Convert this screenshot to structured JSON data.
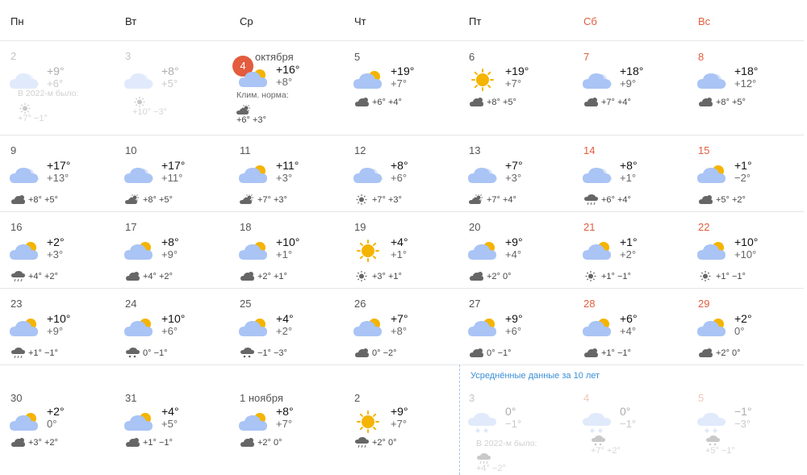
{
  "weekdays": [
    {
      "label": "Пн",
      "weekend": false
    },
    {
      "label": "Вт",
      "weekend": false
    },
    {
      "label": "Ср",
      "weekend": false
    },
    {
      "label": "Чт",
      "weekend": false
    },
    {
      "label": "Пт",
      "weekend": false
    },
    {
      "label": "Сб",
      "weekend": true
    },
    {
      "label": "Вс",
      "weekend": true
    }
  ],
  "today": {
    "day": "4",
    "month": "октября",
    "tmax": "+16°",
    "tmin": "+8°",
    "clim_label": "Клим. норма:",
    "clim": "+6° +3°",
    "icon": "partly-cloudy-icon",
    "clim_icon": "partly-sunny-icon"
  },
  "past": [
    {
      "day": "2",
      "tmax": "+9°",
      "tmin": "+6°",
      "icon": "cloudy-icon",
      "lastyear_label": "В 2022-м было:",
      "lastyear": "+7° −1°",
      "lastyear_icon": "sun-icon"
    },
    {
      "day": "3",
      "tmax": "+8°",
      "tmin": "+5°",
      "icon": "cloudy-icon",
      "lastyear": "+10° −3°",
      "lastyear_icon": "sun-icon"
    }
  ],
  "weeks": [
    [
      null,
      null,
      null,
      {
        "day": "5",
        "tmax": "+19°",
        "tmin": "+7°",
        "icon": "partly-cloudy-icon",
        "night": "+6° +4°",
        "night_icon": "cloud-sun-icon",
        "weekend": false
      },
      {
        "day": "6",
        "tmax": "+19°",
        "tmin": "+7°",
        "icon": "sun-icon",
        "night": "+8° +5°",
        "night_icon": "cloud-sun-icon",
        "weekend": false
      },
      {
        "day": "7",
        "tmax": "+18°",
        "tmin": "+9°",
        "icon": "cloudy-icon",
        "night": "+7° +4°",
        "night_icon": "cloud-sun-icon",
        "weekend": true
      },
      {
        "day": "8",
        "tmax": "+18°",
        "tmin": "+12°",
        "icon": "cloudy-icon",
        "night": "+8° +5°",
        "night_icon": "cloud-sun-icon",
        "weekend": true
      }
    ],
    [
      {
        "day": "9",
        "tmax": "+17°",
        "tmin": "+13°",
        "icon": "cloudy-icon",
        "night": "+8° +5°",
        "night_icon": "cloud-sun-icon",
        "weekend": false
      },
      {
        "day": "10",
        "tmax": "+17°",
        "tmin": "+11°",
        "icon": "cloudy-icon",
        "night": "+8° +5°",
        "night_icon": "partly-sunny-icon",
        "weekend": false
      },
      {
        "day": "11",
        "tmax": "+11°",
        "tmin": "+3°",
        "icon": "partly-cloudy-icon",
        "night": "+7° +3°",
        "night_icon": "partly-sunny-icon",
        "weekend": false
      },
      {
        "day": "12",
        "tmax": "+8°",
        "tmin": "+6°",
        "icon": "cloudy-icon",
        "night": "+7° +3°",
        "night_icon": "sun-icon",
        "weekend": false
      },
      {
        "day": "13",
        "tmax": "+7°",
        "tmin": "+3°",
        "icon": "cloudy-icon",
        "night": "+7° +4°",
        "night_icon": "partly-sunny-icon",
        "weekend": false
      },
      {
        "day": "14",
        "tmax": "+8°",
        "tmin": "+1°",
        "icon": "cloudy-icon",
        "night": "+6° +4°",
        "night_icon": "rain-sun-icon",
        "weekend": true
      },
      {
        "day": "15",
        "tmax": "+1°",
        "tmin": "−2°",
        "icon": "partly-cloudy-icon",
        "night": "+5° +2°",
        "night_icon": "cloud-sun-icon",
        "weekend": true
      }
    ],
    [
      {
        "day": "16",
        "tmax": "+2°",
        "tmin": "+3°",
        "icon": "partly-cloudy-icon",
        "night": "+4° +2°",
        "night_icon": "rain-icon",
        "weekend": false
      },
      {
        "day": "17",
        "tmax": "+8°",
        "tmin": "+9°",
        "icon": "partly-cloudy-icon",
        "night": "+4° +2°",
        "night_icon": "cloud-sun-icon",
        "weekend": false
      },
      {
        "day": "18",
        "tmax": "+10°",
        "tmin": "+1°",
        "icon": "partly-cloudy-icon",
        "night": "+2° +1°",
        "night_icon": "cloud-sun-icon",
        "weekend": false
      },
      {
        "day": "19",
        "tmax": "+4°",
        "tmin": "+1°",
        "icon": "sun-icon",
        "night": "+3° +1°",
        "night_icon": "sun-icon",
        "weekend": false
      },
      {
        "day": "20",
        "tmax": "+9°",
        "tmin": "+4°",
        "icon": "partly-cloudy-icon",
        "night": "+2° 0°",
        "night_icon": "cloud-sun-icon",
        "weekend": false
      },
      {
        "day": "21",
        "tmax": "+1°",
        "tmin": "+2°",
        "icon": "partly-cloudy-icon",
        "night": "+1° −1°",
        "night_icon": "sun-icon",
        "weekend": true
      },
      {
        "day": "22",
        "tmax": "+10°",
        "tmin": "+10°",
        "icon": "partly-cloudy-icon",
        "night": "+1° −1°",
        "night_icon": "sun-icon",
        "weekend": true
      }
    ],
    [
      {
        "day": "23",
        "tmax": "+10°",
        "tmin": "+9°",
        "icon": "partly-cloudy-icon",
        "night": "+1° −1°",
        "night_icon": "rain-icon",
        "weekend": false
      },
      {
        "day": "24",
        "tmax": "+10°",
        "tmin": "+6°",
        "icon": "partly-cloudy-icon",
        "night": "0° −1°",
        "night_icon": "snow-icon",
        "weekend": false
      },
      {
        "day": "25",
        "tmax": "+4°",
        "tmin": "+2°",
        "icon": "partly-cloudy-icon",
        "night": "−1° −3°",
        "night_icon": "snow-icon",
        "weekend": false
      },
      {
        "day": "26",
        "tmax": "+7°",
        "tmin": "+8°",
        "icon": "partly-cloudy-icon",
        "night": "0° −2°",
        "night_icon": "cloud-sun-icon",
        "weekend": false
      },
      {
        "day": "27",
        "tmax": "+9°",
        "tmin": "+6°",
        "icon": "partly-cloudy-icon",
        "night": "0° −1°",
        "night_icon": "cloud-sun-icon",
        "weekend": false
      },
      {
        "day": "28",
        "tmax": "+6°",
        "tmin": "+4°",
        "icon": "partly-cloudy-icon",
        "night": "+1° −1°",
        "night_icon": "cloud-sun-icon",
        "weekend": true
      },
      {
        "day": "29",
        "tmax": "+2°",
        "tmin": "0°",
        "icon": "partly-cloudy-icon",
        "night": "+2° 0°",
        "night_icon": "cloud-sun-icon",
        "weekend": true
      }
    ],
    [
      {
        "day": "30",
        "tmax": "+2°",
        "tmin": "0°",
        "icon": "partly-cloudy-icon",
        "night": "+3° +2°",
        "night_icon": "cloud-sun-icon",
        "weekend": false
      },
      {
        "day": "31",
        "tmax": "+4°",
        "tmin": "+5°",
        "icon": "partly-cloudy-icon",
        "night": "+1° −1°",
        "night_icon": "cloud-sun-icon",
        "weekend": false
      },
      {
        "day": "1 ноября",
        "tmax": "+8°",
        "tmin": "+7°",
        "icon": "partly-cloudy-icon",
        "night": "+2° 0°",
        "night_icon": "cloud-sun-icon",
        "weekend": false
      },
      {
        "day": "2",
        "tmax": "+9°",
        "tmin": "+7°",
        "icon": "sun-icon",
        "night": "+2° 0°",
        "night_icon": "rain-sun-icon",
        "weekend": false
      }
    ]
  ],
  "averaged": {
    "title": "Усреднённые данные за 10 лет",
    "lastyear_label": "В 2022-м было:",
    "days": [
      {
        "day": "3",
        "tmax": "0°",
        "tmin": "−1°",
        "icon": "snow-icon",
        "lastyear": "+4° −2°",
        "lastyear_icon": "rain-icon",
        "weekend": false
      },
      {
        "day": "4",
        "tmax": "0°",
        "tmin": "−1°",
        "icon": "snow-icon",
        "lastyear": "+7° +2°",
        "lastyear_icon": "snow-icon",
        "weekend": true
      },
      {
        "day": "5",
        "tmax": "−1°",
        "tmin": "−3°",
        "icon": "snow-icon",
        "lastyear": "+5° −1°",
        "lastyear_icon": "snow-icon",
        "weekend": true
      }
    ]
  },
  "colors": {
    "weekend": "#e25c3d",
    "cloud": "#a9c4f5",
    "sun": "#f5b400",
    "grid": "#e6e6e6",
    "accent": "#3b8fd6"
  }
}
